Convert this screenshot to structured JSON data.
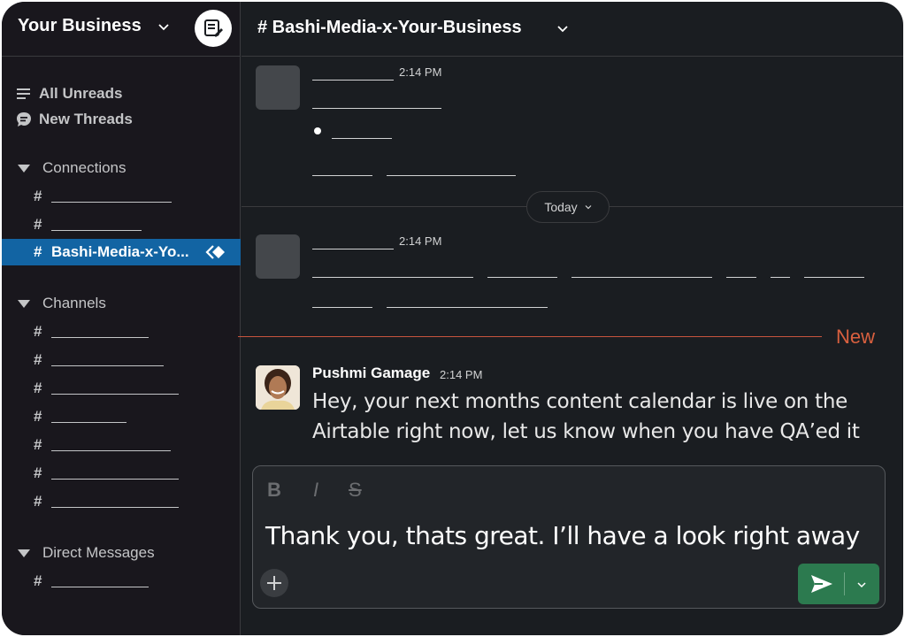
{
  "workspace": {
    "name": "Your Business"
  },
  "sidebar": {
    "nav": [
      {
        "label": "All Unreads",
        "icon": "list-icon"
      },
      {
        "label": "New Threads",
        "icon": "threads-icon"
      }
    ],
    "sections": [
      {
        "label": "Connections"
      },
      {
        "label": "Channels"
      },
      {
        "label": "Direct Messages"
      }
    ],
    "active_channel": "Bashi-Media-x-Yo..."
  },
  "channel": {
    "title": "# Bashi-Media-x-Your-Business"
  },
  "messages": {
    "placeholder_time_1": "2:14 PM",
    "placeholder_time_2": "2:14 PM",
    "today_label": "Today",
    "new_label": "New",
    "last": {
      "sender": "Pushmi Gamage",
      "time": "2:14 PM",
      "text": "Hey, your next months content calendar is live on the Airtable right now, let us know when you have QA’ed it"
    }
  },
  "composer": {
    "bold": "B",
    "italic": "I",
    "strike": "S",
    "text": "Thank you, thats great. I’ll have a look right away"
  },
  "colors": {
    "active_channel_bg": "#1264a3",
    "new_divider": "#c8553d",
    "send_button": "#2c7a4f"
  }
}
